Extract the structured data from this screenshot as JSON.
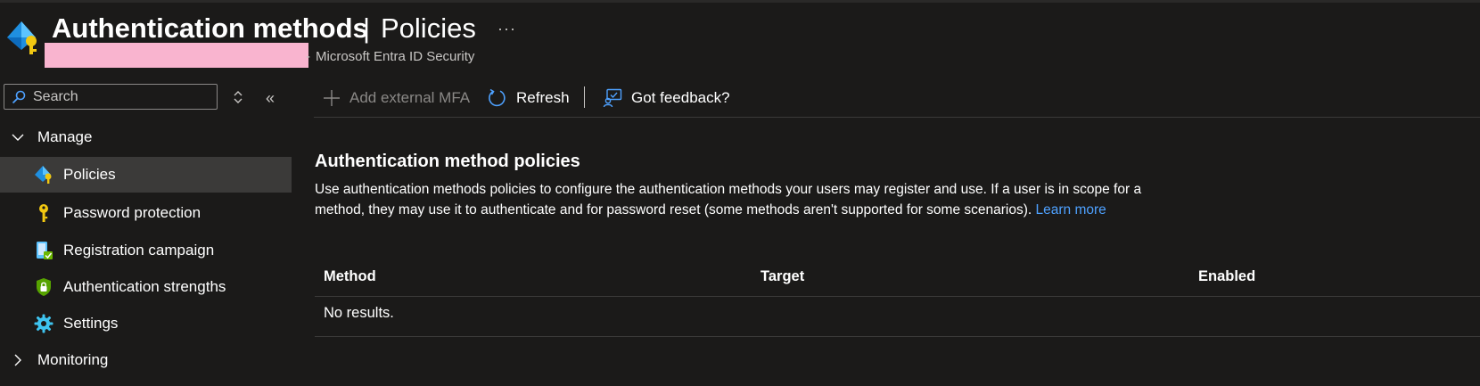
{
  "header": {
    "title": "Authentication methods",
    "separator": "|",
    "subtitle_page": "Policies",
    "more": "···",
    "breadcrumb_dash": "-",
    "breadcrumb_service": "Microsoft Entra ID Security"
  },
  "sidebar": {
    "search_placeholder": "Search",
    "collapse_glyph": "«",
    "manage_label": "Manage",
    "items": [
      {
        "label": "Policies",
        "icon": "auth-methods-icon",
        "active": true
      },
      {
        "label": "Password protection",
        "icon": "key-icon"
      },
      {
        "label": "Registration campaign",
        "icon": "device-check-icon"
      },
      {
        "label": "Authentication strengths",
        "icon": "shield-lock-icon"
      },
      {
        "label": "Settings",
        "icon": "gear-icon"
      }
    ],
    "monitoring_label": "Monitoring"
  },
  "toolbar": {
    "add_label": "Add external MFA",
    "refresh_label": "Refresh",
    "feedback_label": "Got feedback?"
  },
  "main": {
    "section_title": "Authentication method policies",
    "description": "Use authentication methods policies to configure the authentication methods your users may register and use. If a user is in scope for a method, they may use it to authenticate and for password reset (some methods aren't supported for some scenarios).",
    "learn_more": "Learn more",
    "table": {
      "columns": [
        "Method",
        "Target",
        "Enabled"
      ],
      "empty_text": "No results."
    }
  },
  "colors": {
    "background": "#1b1a19",
    "accent_link": "#4ea1ff",
    "active_row": "#3b3a39",
    "redaction": "#f9b4cf"
  }
}
